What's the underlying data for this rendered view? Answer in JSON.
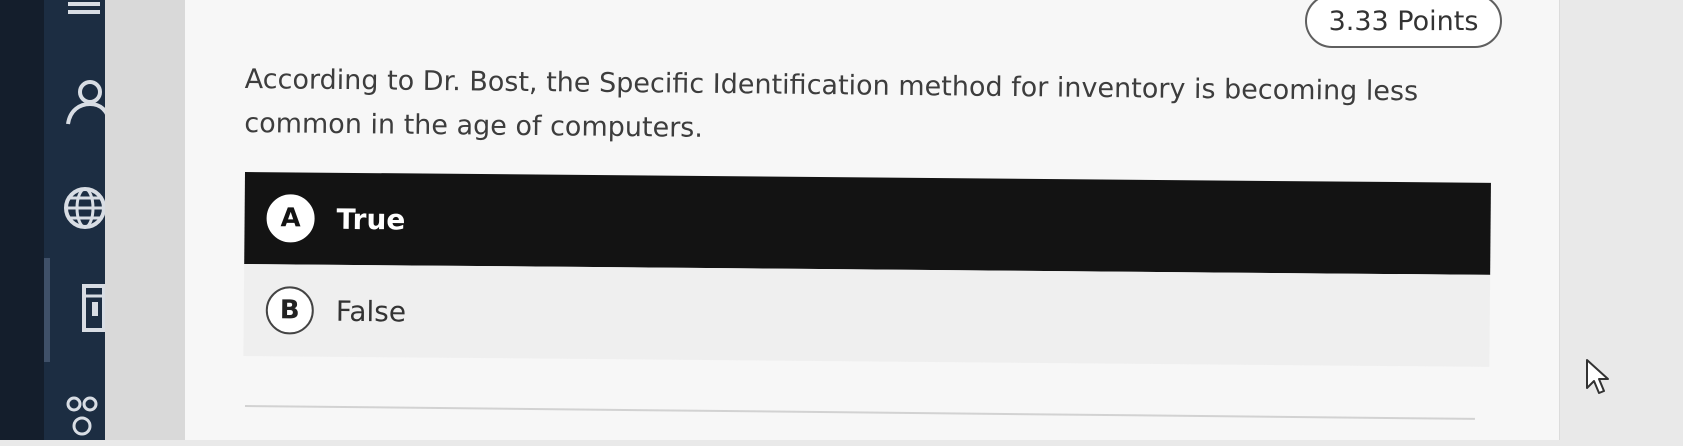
{
  "sidebar": {
    "icons": [
      "course-icon",
      "person-icon",
      "globe-icon",
      "gradebook-icon",
      "groups-icon"
    ]
  },
  "question": {
    "points": "3.33 Points",
    "text": "According to Dr. Bost, the Specific Identification method for inventory is becoming less common in the age of computers.",
    "options": [
      {
        "letter": "A",
        "label": "True",
        "selected": true
      },
      {
        "letter": "B",
        "label": "False",
        "selected": false
      }
    ]
  },
  "colors": {
    "sidebar": "#1c2d42",
    "selected_option_bg": "#131313",
    "card_bg": "#f7f7f7"
  },
  "icons": [
    "mouse-pointer-icon"
  ]
}
